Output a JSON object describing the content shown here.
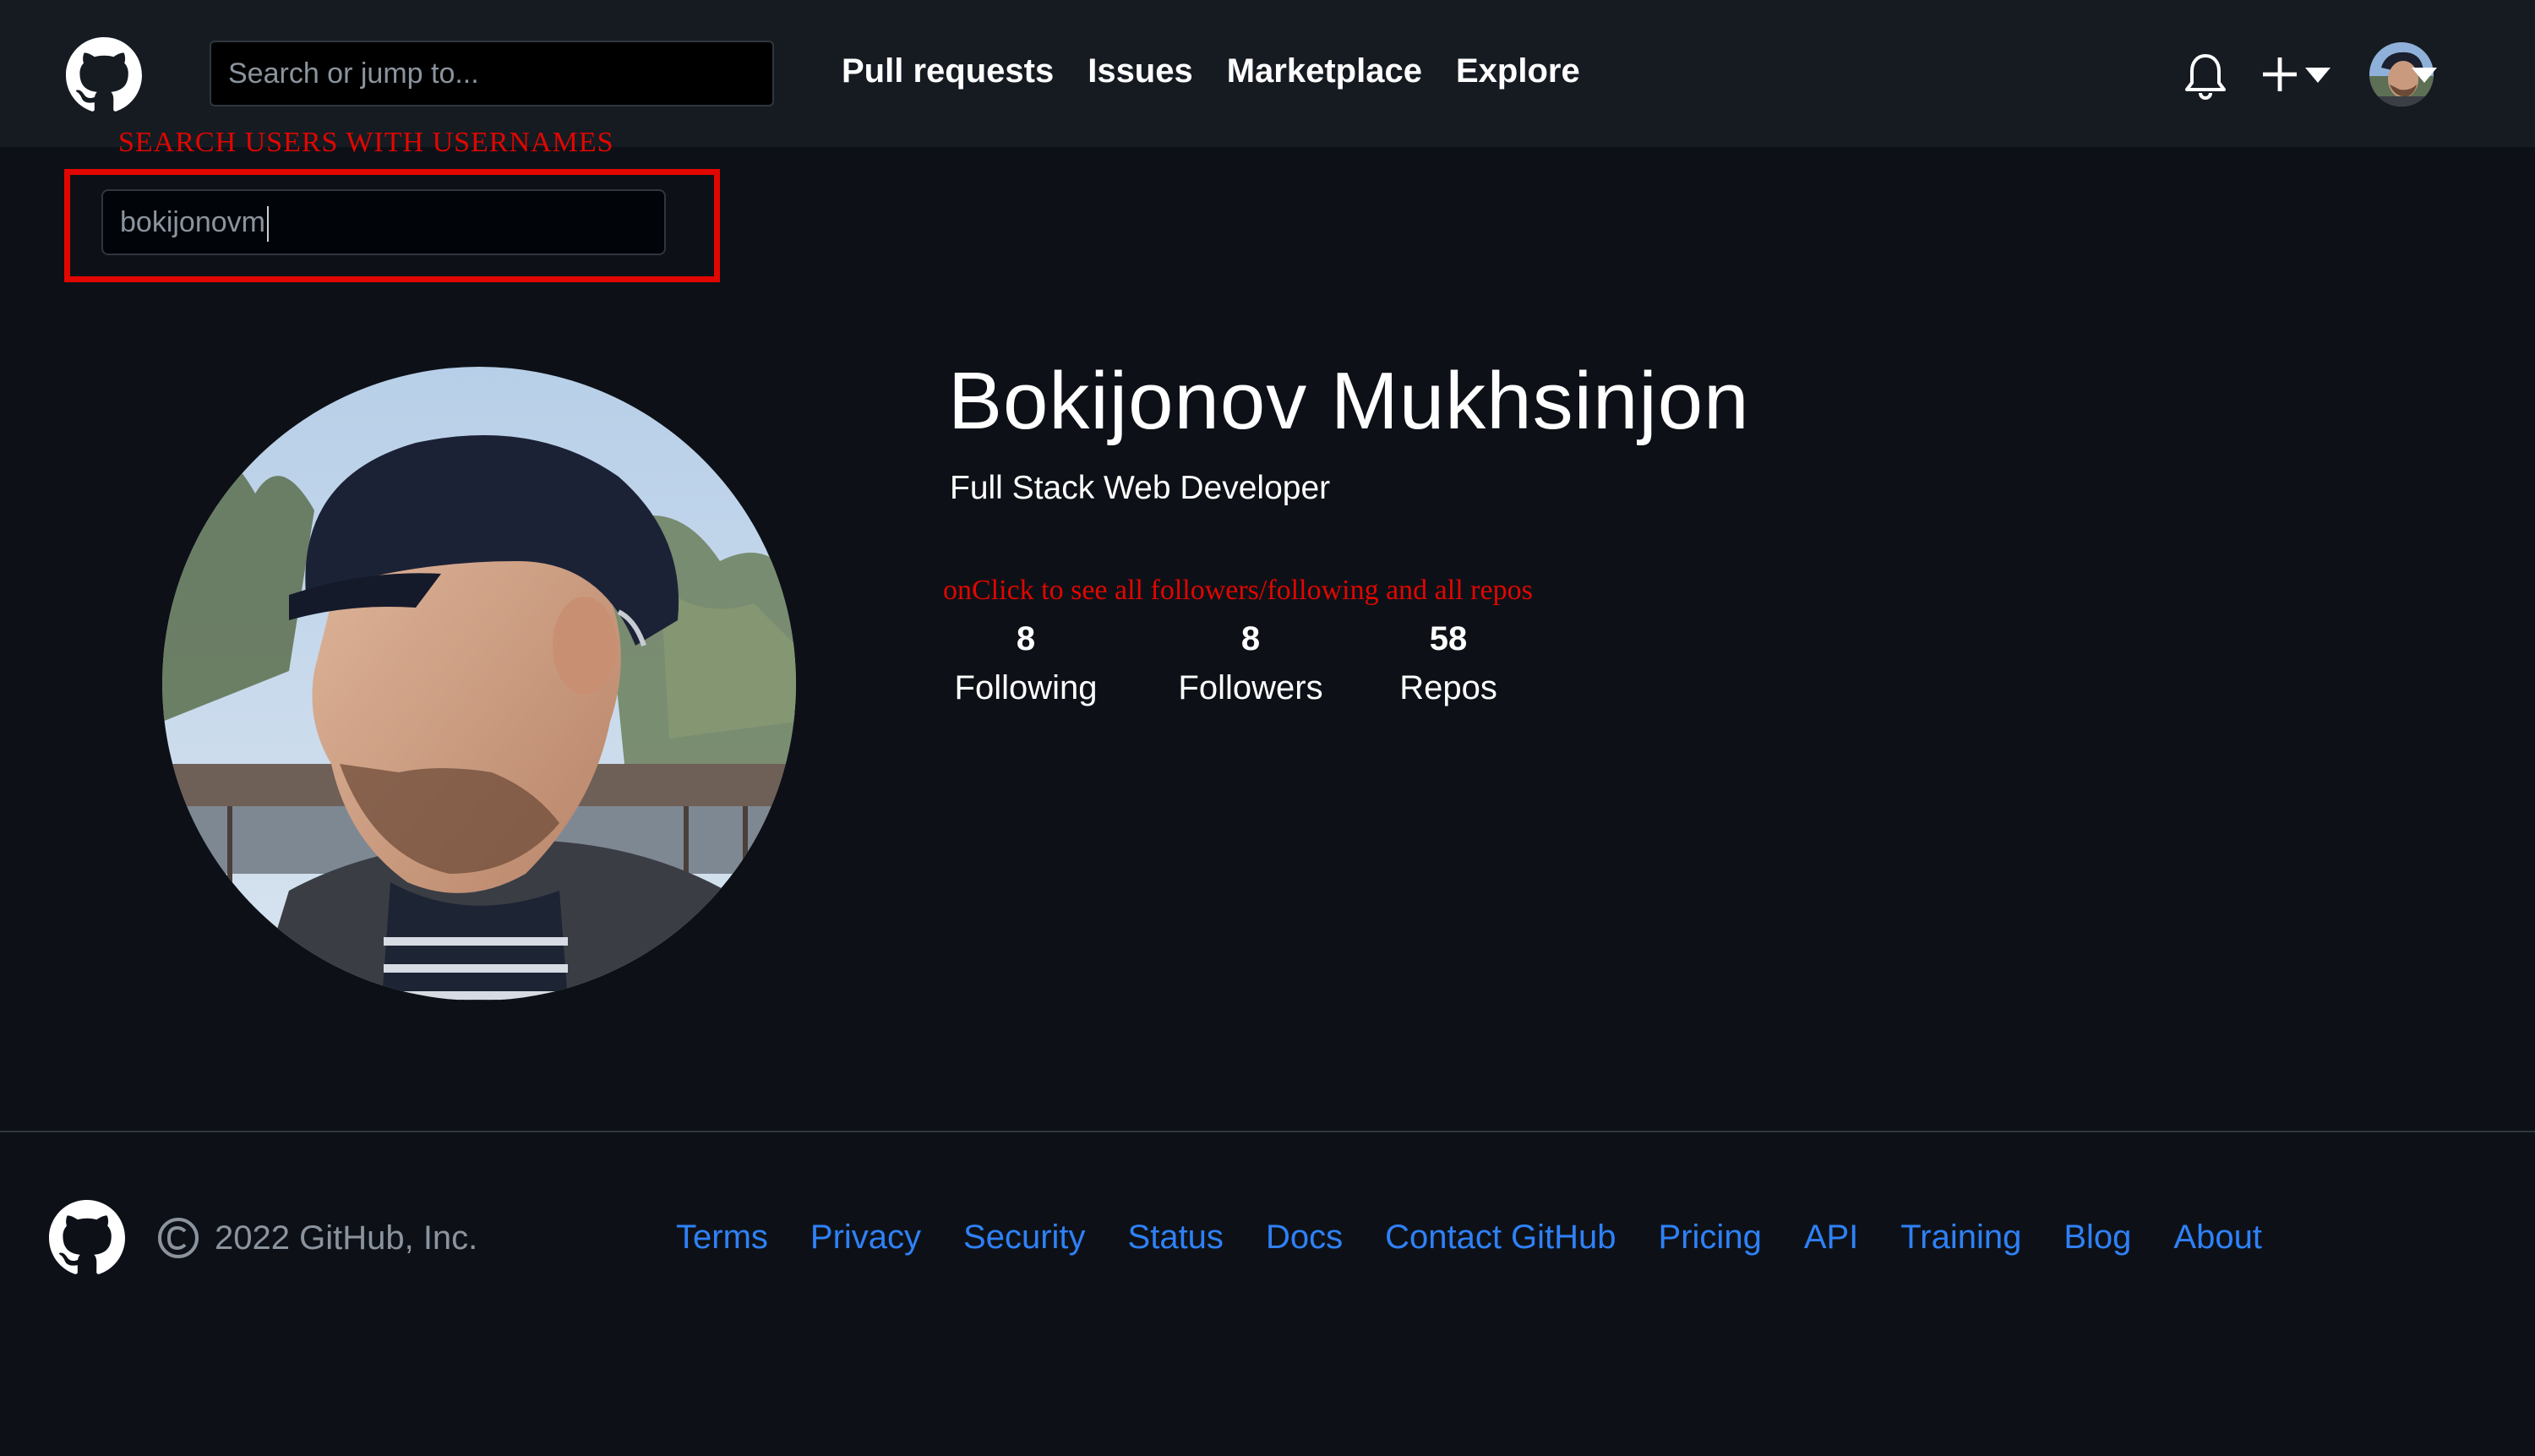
{
  "header": {
    "search_placeholder": "Search or jump to...",
    "nav": [
      "Pull requests",
      "Issues",
      "Marketplace",
      "Explore"
    ],
    "icons": [
      "github-logo",
      "bell-icon",
      "plus-icon",
      "caret-down-icon",
      "avatar"
    ]
  },
  "annotations": {
    "search": "SEARCH USERS WITH USERNAMES",
    "stats": "onClick to see all followers/following and all repos",
    "color": "#e10600"
  },
  "user_search": {
    "value": "bokijonovm"
  },
  "profile": {
    "name": "Bokijonov Mukhsinjon",
    "bio": "Full Stack Web Developer",
    "stats": [
      {
        "value": "8",
        "label": "Following"
      },
      {
        "value": "8",
        "label": "Followers"
      },
      {
        "value": "58",
        "label": "Repos"
      }
    ]
  },
  "footer": {
    "copyright": "2022 GitHub, Inc.",
    "links": [
      "Terms",
      "Privacy",
      "Security",
      "Status",
      "Docs",
      "Contact GitHub",
      "Pricing",
      "API",
      "Training",
      "Blog",
      "About"
    ],
    "link_color": "#2f81f7"
  }
}
